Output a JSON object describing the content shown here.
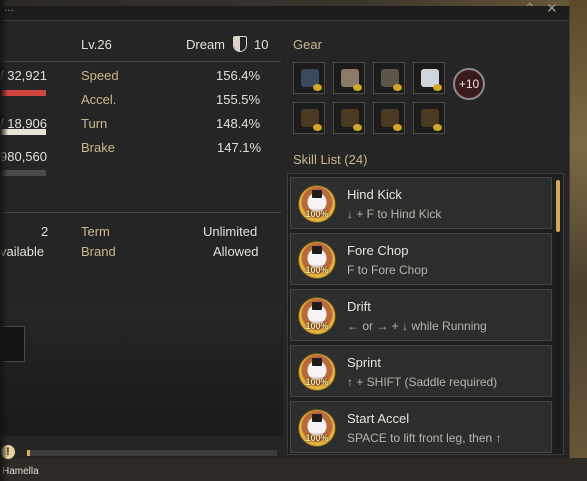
{
  "window": {
    "title_partial": "..."
  },
  "stats": {
    "level": "Lv.26",
    "dream_label": "Dream",
    "dream_value": "10",
    "hp_partial": "/ 32,921",
    "stamina_partial": "/ 18,906",
    "weight_partial": "980,560",
    "speed_label": "Speed",
    "speed_value": "156.4%",
    "accel_label": "Accel.",
    "accel_value": "155.5%",
    "turn_label": "Turn",
    "turn_value": "148.4%",
    "brake_label": "Brake",
    "brake_value": "147.1%",
    "left_count": "2",
    "available_partial": "vailable",
    "term_label": "Term",
    "term_value": "Unlimited",
    "brand_label": "Brand",
    "brand_value": "Allowed"
  },
  "gear": {
    "label": "Gear",
    "enhance_badge": "+10",
    "slots_row1": [
      "horse-armor-icon",
      "saddle-icon",
      "stirrups-icon",
      "horseshoe-icon",
      "horse-helm-icon"
    ],
    "slots_row2": [
      "empty-armor-slot-icon",
      "empty-saddle-slot-icon",
      "empty-stirrups-slot-icon",
      "empty-horseshoe-slot-icon"
    ]
  },
  "skills": {
    "header": "Skill List (24)",
    "items": [
      {
        "name": "Hind Kick",
        "desc": "↓ + F to Hind Kick",
        "mastery": "100%"
      },
      {
        "name": "Fore Chop",
        "desc": "F to Fore Chop",
        "mastery": "100%"
      },
      {
        "name": "Drift",
        "desc": "← or → + ↓ while Running",
        "mastery": "100%"
      },
      {
        "name": "Sprint",
        "desc": "↑ + SHIFT (Saddle required)",
        "mastery": "100%"
      },
      {
        "name": "Start Accel",
        "desc": "SPACE to lift front leg, then ↑",
        "mastery": "100%"
      }
    ]
  },
  "footer": {
    "warn_glyph": "!",
    "player_name": "Hamella",
    "progress": 0.01
  },
  "colors": {
    "hp_bar": "#d0463f",
    "stamina_bar": "#e6e2d6",
    "gold": "#d9b24a"
  }
}
